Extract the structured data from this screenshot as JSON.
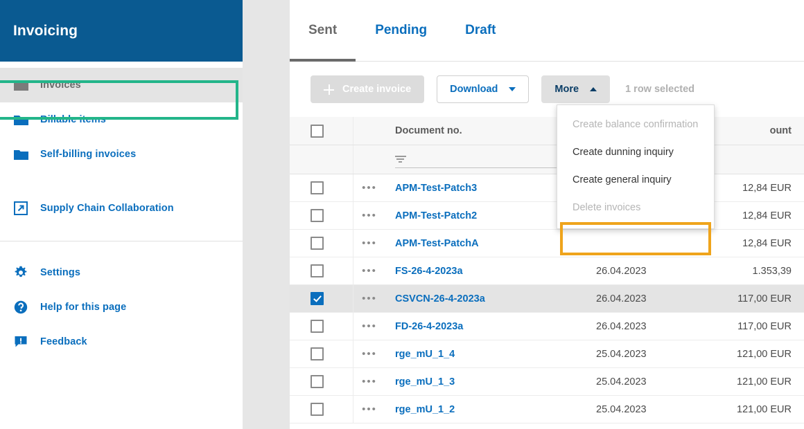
{
  "sidebar": {
    "title": "Invoicing",
    "groups": [
      {
        "items": [
          {
            "label": "Invoices",
            "icon": "folder-icon",
            "active": true
          },
          {
            "label": "Billable items",
            "icon": "folder-icon",
            "active": false
          },
          {
            "label": "Self-billing invoices",
            "icon": "folder-icon",
            "active": false
          }
        ]
      },
      {
        "items": [
          {
            "label": "Supply Chain Collaboration",
            "icon": "external-link-icon",
            "active": false
          }
        ]
      },
      {
        "items": [
          {
            "label": "Settings",
            "icon": "gear-icon",
            "active": false
          },
          {
            "label": "Help for this page",
            "icon": "question-circle-icon",
            "active": false
          },
          {
            "label": "Feedback",
            "icon": "speech-bubble-icon",
            "active": false
          }
        ]
      }
    ]
  },
  "tabs": [
    {
      "label": "Sent",
      "active": true
    },
    {
      "label": "Pending",
      "active": false
    },
    {
      "label": "Draft",
      "active": false
    }
  ],
  "toolbar": {
    "create_invoice_label": "Create invoice",
    "download_label": "Download",
    "more_label": "More",
    "selection_status": "1 row selected"
  },
  "more_menu": {
    "items": [
      {
        "label": "Create balance confirmation",
        "disabled": true,
        "highlighted": false
      },
      {
        "label": "Create dunning inquiry",
        "disabled": false,
        "highlighted": false
      },
      {
        "label": "Create general inquiry",
        "disabled": false,
        "highlighted": false
      },
      {
        "label": "Delete invoices",
        "disabled": true,
        "highlighted": true
      }
    ]
  },
  "table": {
    "columns": [
      "Document no.",
      "",
      "Amount"
    ],
    "header_doc": "Document no.",
    "header_amount": "ount",
    "rows": [
      {
        "checked": false,
        "document_no": "APM-Test-Patch3",
        "date": "",
        "amount": "12,84 EUR"
      },
      {
        "checked": false,
        "document_no": "APM-Test-Patch2",
        "date": "",
        "amount": "12,84 EUR"
      },
      {
        "checked": false,
        "document_no": "APM-Test-PatchA",
        "date": "",
        "amount": "12,84 EUR"
      },
      {
        "checked": false,
        "document_no": "FS-26-4-2023a",
        "date": "26.04.2023",
        "amount": "1.353,39"
      },
      {
        "checked": true,
        "document_no": "CSVCN-26-4-2023a",
        "date": "26.04.2023",
        "amount": "117,00 EUR"
      },
      {
        "checked": false,
        "document_no": "FD-26-4-2023a",
        "date": "26.04.2023",
        "amount": "117,00 EUR"
      },
      {
        "checked": false,
        "document_no": "rge_mU_1_4",
        "date": "25.04.2023",
        "amount": "121,00 EUR"
      },
      {
        "checked": false,
        "document_no": "rge_mU_1_3",
        "date": "25.04.2023",
        "amount": "121,00 EUR"
      },
      {
        "checked": false,
        "document_no": "rge_mU_1_2",
        "date": "25.04.2023",
        "amount": "121,00 EUR"
      }
    ]
  },
  "colors": {
    "brand_blue": "#0a5a91",
    "link_blue": "#0a6ebd",
    "highlight_green": "#23b58a",
    "highlight_orange": "#efa41c",
    "selected_row": "#e4e4e4"
  }
}
